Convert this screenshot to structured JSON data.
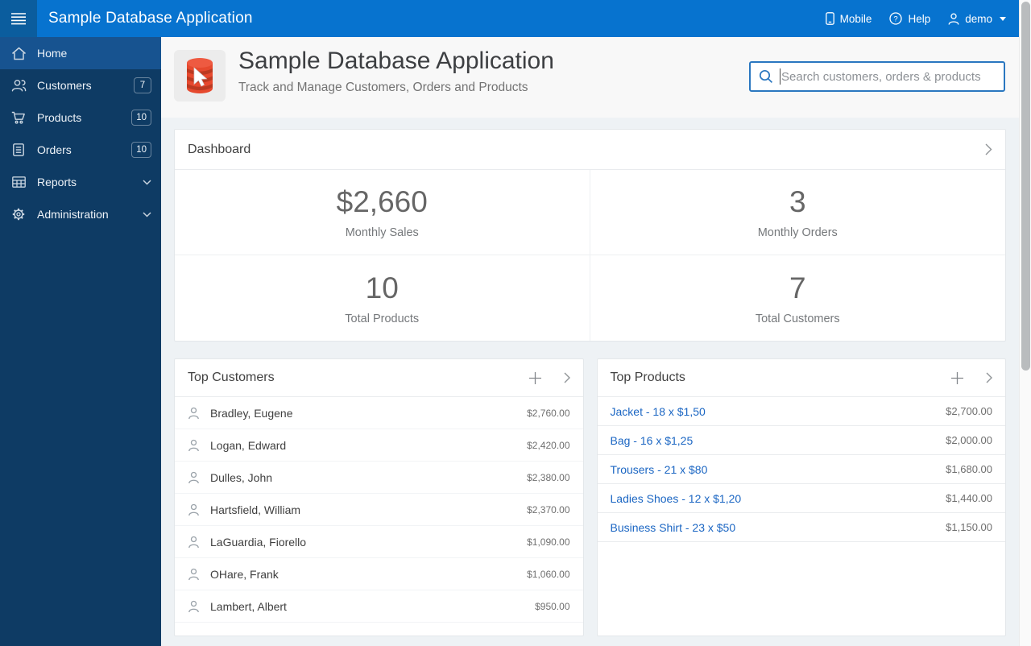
{
  "topbar": {
    "title": "Sample Database Application",
    "mobile_label": "Mobile",
    "help_label": "Help",
    "user_label": "demo",
    "icons": [
      "hamburger-menu-icon",
      "mobile-phone-icon",
      "help-circle-icon",
      "user-icon",
      "caret-down-icon"
    ]
  },
  "sidebar": {
    "items": [
      {
        "label": "Home",
        "icon": "home-icon",
        "selected": true
      },
      {
        "label": "Customers",
        "icon": "customers-icon",
        "badge": "7"
      },
      {
        "label": "Products",
        "icon": "cart-icon",
        "badge": "10"
      },
      {
        "label": "Orders",
        "icon": "orders-list-icon",
        "badge": "10"
      },
      {
        "label": "Reports",
        "icon": "reports-table-icon",
        "expandable": true
      },
      {
        "label": "Administration",
        "icon": "gear-icon",
        "expandable": true
      }
    ]
  },
  "app_header": {
    "title": "Sample Database Application",
    "subtitle": "Track and Manage Customers, Orders and Products",
    "search_placeholder": "Search customers, orders & products",
    "app_icon": "database-cursor-icon"
  },
  "dashboard": {
    "title": "Dashboard",
    "metrics": [
      {
        "value": "$2,660",
        "label": "Monthly Sales"
      },
      {
        "value": "3",
        "label": "Monthly Orders"
      },
      {
        "value": "10",
        "label": "Total Products"
      },
      {
        "value": "7",
        "label": "Total Customers"
      }
    ]
  },
  "top_customers": {
    "title": "Top Customers",
    "rows": [
      {
        "name": "Bradley, Eugene",
        "amount": "$2,760.00"
      },
      {
        "name": "Logan, Edward",
        "amount": "$2,420.00"
      },
      {
        "name": "Dulles, John",
        "amount": "$2,380.00"
      },
      {
        "name": "Hartsfield, William",
        "amount": "$2,370.00"
      },
      {
        "name": "LaGuardia, Fiorello",
        "amount": "$1,090.00"
      },
      {
        "name": "OHare, Frank",
        "amount": "$1,060.00"
      },
      {
        "name": "Lambert, Albert",
        "amount": "$950.00"
      }
    ]
  },
  "top_products": {
    "title": "Top Products",
    "rows": [
      {
        "label": "Jacket - 18 x $1,50",
        "amount": "$2,700.00"
      },
      {
        "label": "Bag - 16 x $1,25",
        "amount": "$2,000.00"
      },
      {
        "label": "Trousers - 21 x $80",
        "amount": "$1,680.00"
      },
      {
        "label": "Ladies Shoes - 12 x $1,20",
        "amount": "$1,440.00"
      },
      {
        "label": "Business Shirt - 23 x $50",
        "amount": "$1,150.00"
      }
    ]
  },
  "colors": {
    "header_blue": "#0773CF",
    "hamburger_blue": "#0B5D9E",
    "sidebar_navy": "#0E3B64",
    "selected_item_blue": "#175390",
    "link_blue": "#1B66C3",
    "search_border_blue": "#2A77C0",
    "app_icon_red": "#E6492E",
    "content_background": "#EEF2F5"
  }
}
